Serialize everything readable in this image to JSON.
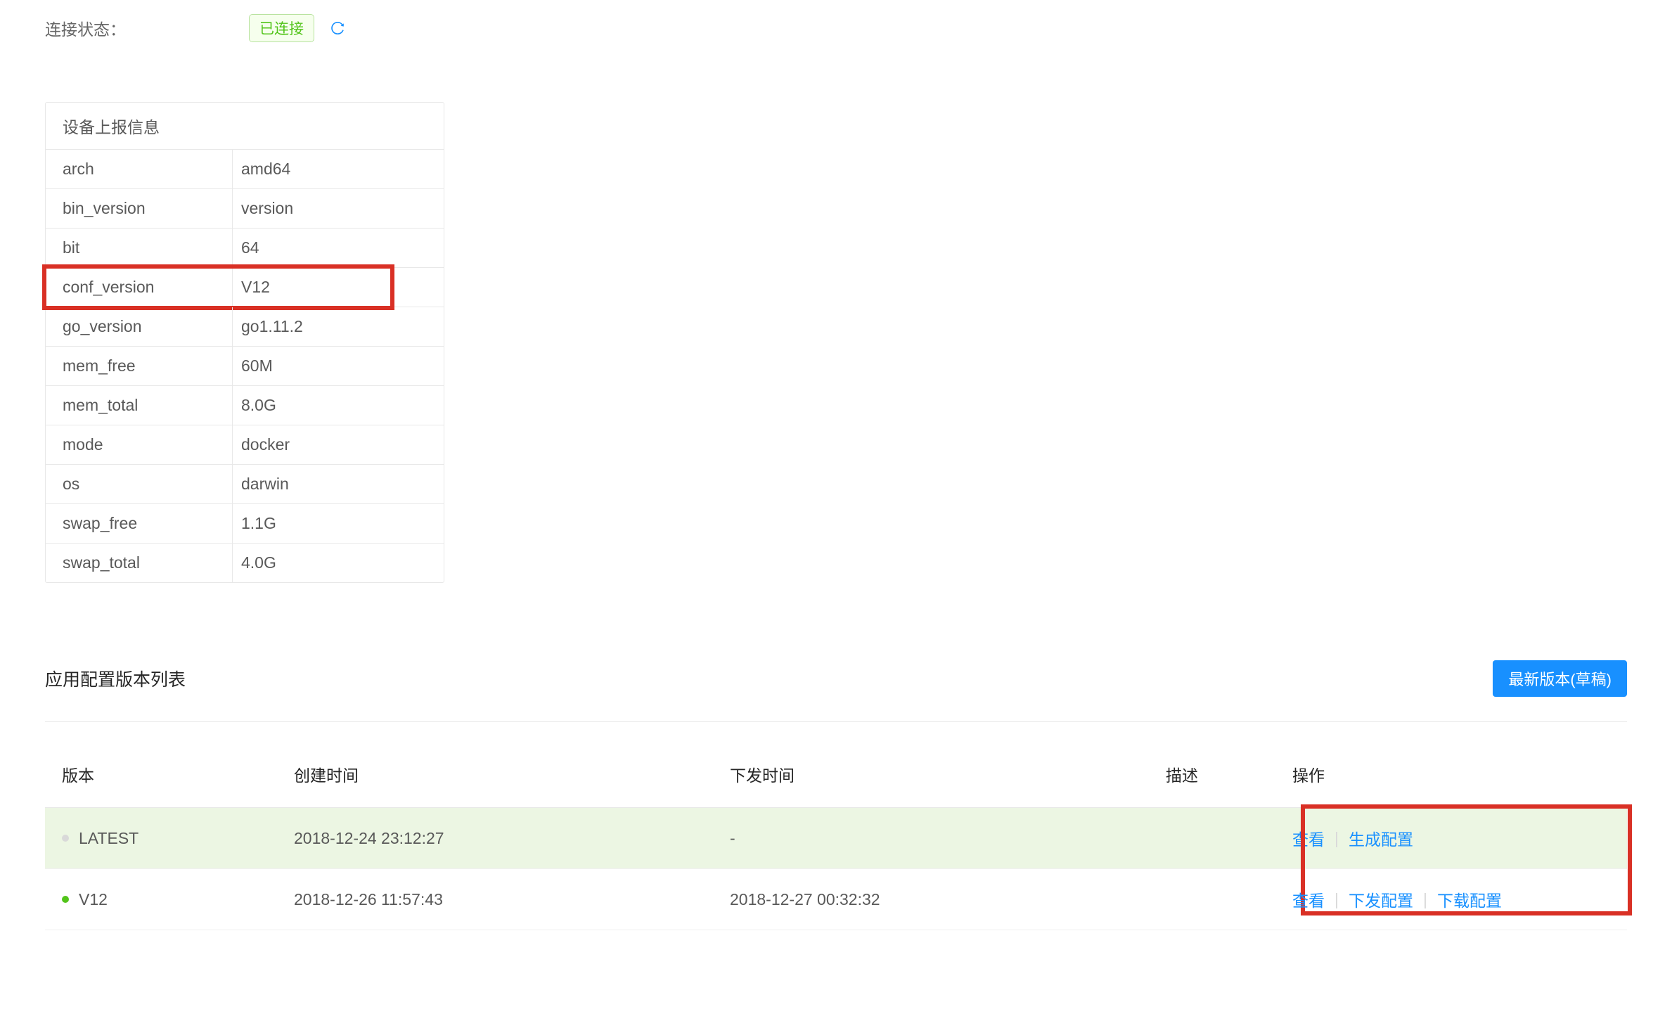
{
  "status": {
    "label": "连接状态：",
    "badge": "已连接"
  },
  "device_info": {
    "title": "设备上报信息",
    "rows": [
      {
        "key": "arch",
        "value": "amd64"
      },
      {
        "key": "bin_version",
        "value": "version"
      },
      {
        "key": "bit",
        "value": "64"
      },
      {
        "key": "conf_version",
        "value": "V12",
        "highlight": true
      },
      {
        "key": "go_version",
        "value": "go1.11.2"
      },
      {
        "key": "mem_free",
        "value": "60M"
      },
      {
        "key": "mem_total",
        "value": "8.0G"
      },
      {
        "key": "mode",
        "value": "docker"
      },
      {
        "key": "os",
        "value": "darwin"
      },
      {
        "key": "swap_free",
        "value": "1.1G"
      },
      {
        "key": "swap_total",
        "value": "4.0G"
      }
    ]
  },
  "versions": {
    "title": "应用配置版本列表",
    "button": "最新版本(草稿)",
    "columns": {
      "version": "版本",
      "created": "创建时间",
      "published": "下发时间",
      "desc": "描述",
      "ops": "操作"
    },
    "rows": [
      {
        "dot": "gray",
        "version": "LATEST",
        "created": "2018-12-24 23:12:27",
        "published": "-",
        "desc": "",
        "ops": [
          "查看",
          "生成配置"
        ],
        "latest": true
      },
      {
        "dot": "green",
        "version": "V12",
        "created": "2018-12-26 11:57:43",
        "published": "2018-12-27 00:32:32",
        "desc": "",
        "ops": [
          "查看",
          "下发配置",
          "下载配置"
        ]
      }
    ]
  }
}
